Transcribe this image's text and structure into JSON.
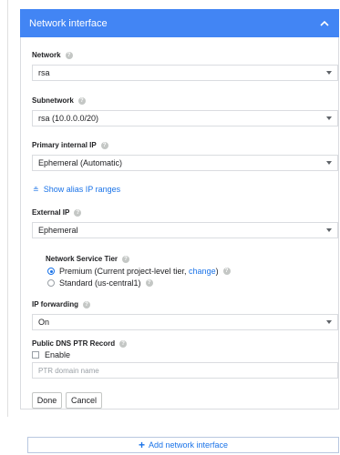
{
  "header": {
    "title": "Network interface",
    "collapse_icon": "chevron-up-icon"
  },
  "network": {
    "label": "Network",
    "value": "rsa"
  },
  "subnetwork": {
    "label": "Subnetwork",
    "value": "rsa (10.0.0.0/20)"
  },
  "primary_ip": {
    "label": "Primary internal IP",
    "value": "Ephemeral (Automatic)"
  },
  "alias": {
    "label": "Show alias IP ranges"
  },
  "external_ip": {
    "label": "External IP",
    "value": "Ephemeral"
  },
  "tier": {
    "label": "Network Service Tier",
    "premium_prefix": "Premium (Current project-level tier, ",
    "premium_link": "change",
    "premium_suffix": ")",
    "standard": "Standard (us-central1)"
  },
  "ip_forwarding": {
    "label": "IP forwarding",
    "value": "On"
  },
  "dns": {
    "label": "Public DNS PTR Record",
    "enable_label": "Enable",
    "placeholder": "PTR domain name"
  },
  "actions": {
    "done": "Done",
    "cancel": "Cancel"
  },
  "add_interface": {
    "label": "Add network interface"
  },
  "colors": {
    "header_bg": "#4285f4",
    "link": "#1a73e8"
  }
}
